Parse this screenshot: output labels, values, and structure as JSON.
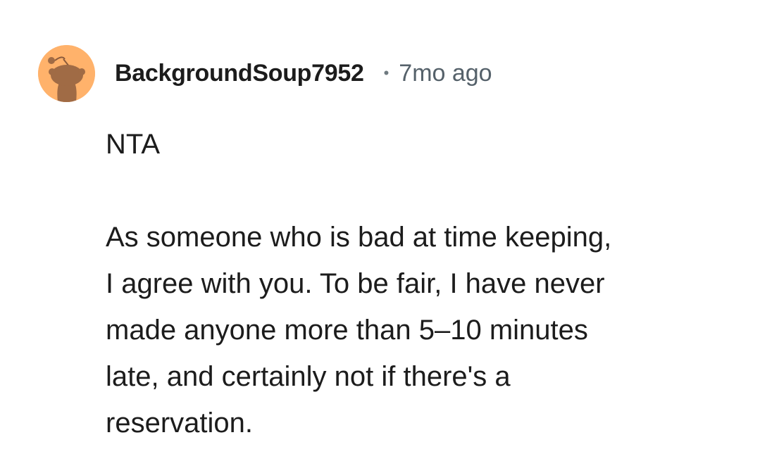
{
  "comment": {
    "author": "BackgroundSoup7952",
    "separator": "•",
    "timestamp": "7mo ago",
    "avatar_icon": "snoo-avatar-icon",
    "avatar_bg": "#ffb26b",
    "verdict": "NTA",
    "lines": [
      "As someone who is bad at time keeping,",
      "I agree with you. To be fair, I have never",
      "made anyone more than 5–10 minutes",
      "late, and certainly not if there's a",
      "reservation."
    ]
  }
}
